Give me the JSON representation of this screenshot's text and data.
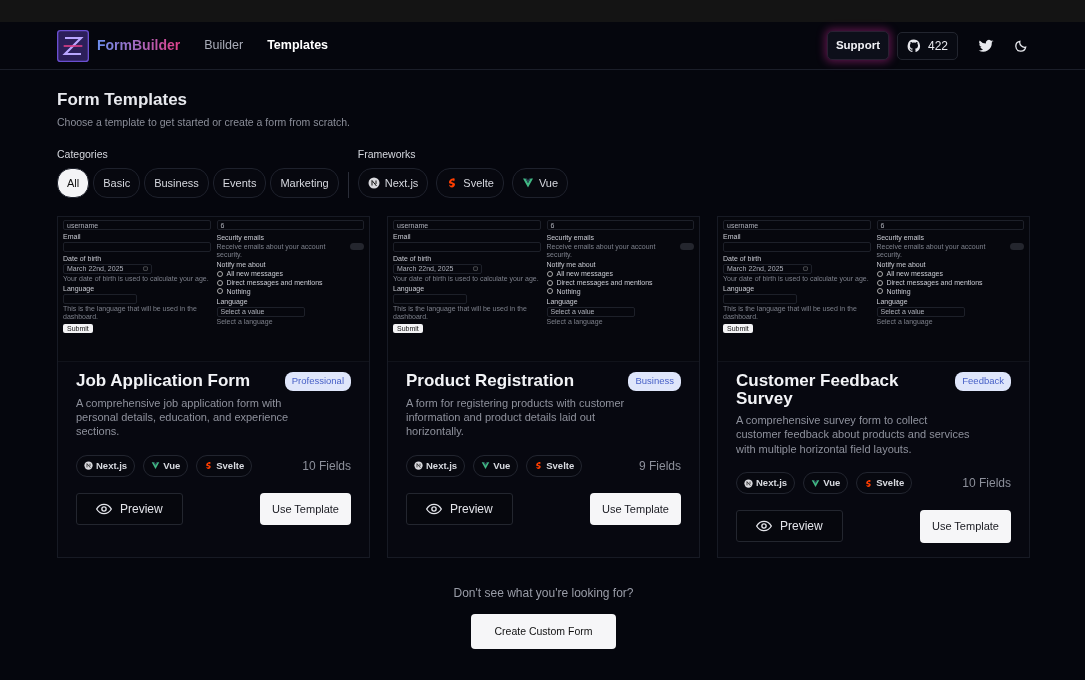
{
  "navbar": {
    "brand": "FormBuilder",
    "links": [
      {
        "label": "Builder",
        "selected": false
      },
      {
        "label": "Templates",
        "selected": true
      }
    ],
    "support": "Support",
    "github_stars": "422"
  },
  "header": {
    "title": "Form Templates",
    "subtitle": "Choose a template to get started or create a form from scratch."
  },
  "filters": {
    "categories_label": "Categories",
    "categories": [
      {
        "label": "All",
        "selected": true
      },
      {
        "label": "Basic",
        "selected": false
      },
      {
        "label": "Business",
        "selected": false
      },
      {
        "label": "Events",
        "selected": false
      },
      {
        "label": "Marketing",
        "selected": false
      }
    ],
    "frameworks_label": "Frameworks",
    "frameworks": [
      {
        "label": "Next.js",
        "kind": "next",
        "selected": false
      },
      {
        "label": "Svelte",
        "kind": "svelte",
        "selected": false
      },
      {
        "label": "Vue",
        "kind": "vue",
        "selected": false
      }
    ]
  },
  "templates": [
    {
      "title": "Job Application Form",
      "badge": "Professional",
      "description": "A comprehensive job application form with personal details, education, and experience sections.",
      "frameworks": [
        {
          "label": "Next.js",
          "kind": "next"
        },
        {
          "label": "Vue",
          "kind": "vue"
        },
        {
          "label": "Svelte",
          "kind": "svelte"
        }
      ],
      "fields": "10 Fields",
      "preview_button": "Preview",
      "use_button": "Use Template",
      "preview": {
        "username": "username",
        "count": "6",
        "email_label": "Email",
        "dob_label": "Date of birth",
        "dob_value": "March 22nd, 2025",
        "dob_help": "Your date of birth is used to calculate your age.",
        "language_label": "Language",
        "language_help": "This is the language that will be used in the dashboard.",
        "submit": "Submit",
        "security_title": "Security emails",
        "security_desc": "Receive emails about your account security.",
        "security_on": false,
        "notify_label": "Notify me about",
        "options": [
          {
            "label": "All new messages",
            "selected": false
          },
          {
            "label": "Direct messages and mentions",
            "selected": false
          },
          {
            "label": "Nothing",
            "selected": false
          }
        ],
        "language2_label": "Language",
        "language2_placeholder": "Select a value",
        "language2_help": "Select a language"
      }
    },
    {
      "title": "Product Registration",
      "badge": "Business",
      "description": "A form for registering products with customer information and product details laid out horizontally.",
      "frameworks": [
        {
          "label": "Next.js",
          "kind": "next"
        },
        {
          "label": "Vue",
          "kind": "vue"
        },
        {
          "label": "Svelte",
          "kind": "svelte"
        }
      ],
      "fields": "9 Fields",
      "preview_button": "Preview",
      "use_button": "Use Template",
      "preview": {
        "username": "username",
        "count": "6",
        "email_label": "Email",
        "dob_label": "Date of birth",
        "dob_value": "March 22nd, 2025",
        "dob_help": "Your date of birth is used to calculate your age.",
        "language_label": "Language",
        "language_help": "This is the language that will be used in the dashboard.",
        "submit": "Submit",
        "security_title": "Security emails",
        "security_desc": "Receive emails about your account security.",
        "security_on": false,
        "notify_label": "Notify me about",
        "options": [
          {
            "label": "All new messages",
            "selected": false
          },
          {
            "label": "Direct messages and mentions",
            "selected": false
          },
          {
            "label": "Nothing",
            "selected": false
          }
        ],
        "language2_label": "Language",
        "language2_placeholder": "Select a value",
        "language2_help": "Select a language"
      }
    },
    {
      "title": "Customer Feedback Survey",
      "badge": "Feedback",
      "description": "A comprehensive survey form to collect customer feedback about products and services with multiple horizontal field layouts.",
      "frameworks": [
        {
          "label": "Next.js",
          "kind": "next"
        },
        {
          "label": "Vue",
          "kind": "vue"
        },
        {
          "label": "Svelte",
          "kind": "svelte"
        }
      ],
      "fields": "10 Fields",
      "preview_button": "Preview",
      "use_button": "Use Template",
      "preview": {
        "username": "username",
        "count": "6",
        "email_label": "Email",
        "dob_label": "Date of birth",
        "dob_value": "March 22nd, 2025",
        "dob_help": "Your date of birth is used to calculate your age.",
        "language_label": "Language",
        "language_help": "This is the language that will be used in the dashboard.",
        "submit": "Submit",
        "security_title": "Security emails",
        "security_desc": "Receive emails about your account security.",
        "security_on": false,
        "notify_label": "Notify me about",
        "options": [
          {
            "label": "All new messages",
            "selected": false
          },
          {
            "label": "Direct messages and mentions",
            "selected": false
          },
          {
            "label": "Nothing",
            "selected": false
          }
        ],
        "language2_label": "Language",
        "language2_placeholder": "Select a value",
        "language2_help": "Select a language"
      }
    }
  ],
  "footer": {
    "prompt": "Don't see what you're looking for?",
    "button": "Create Custom Form"
  }
}
